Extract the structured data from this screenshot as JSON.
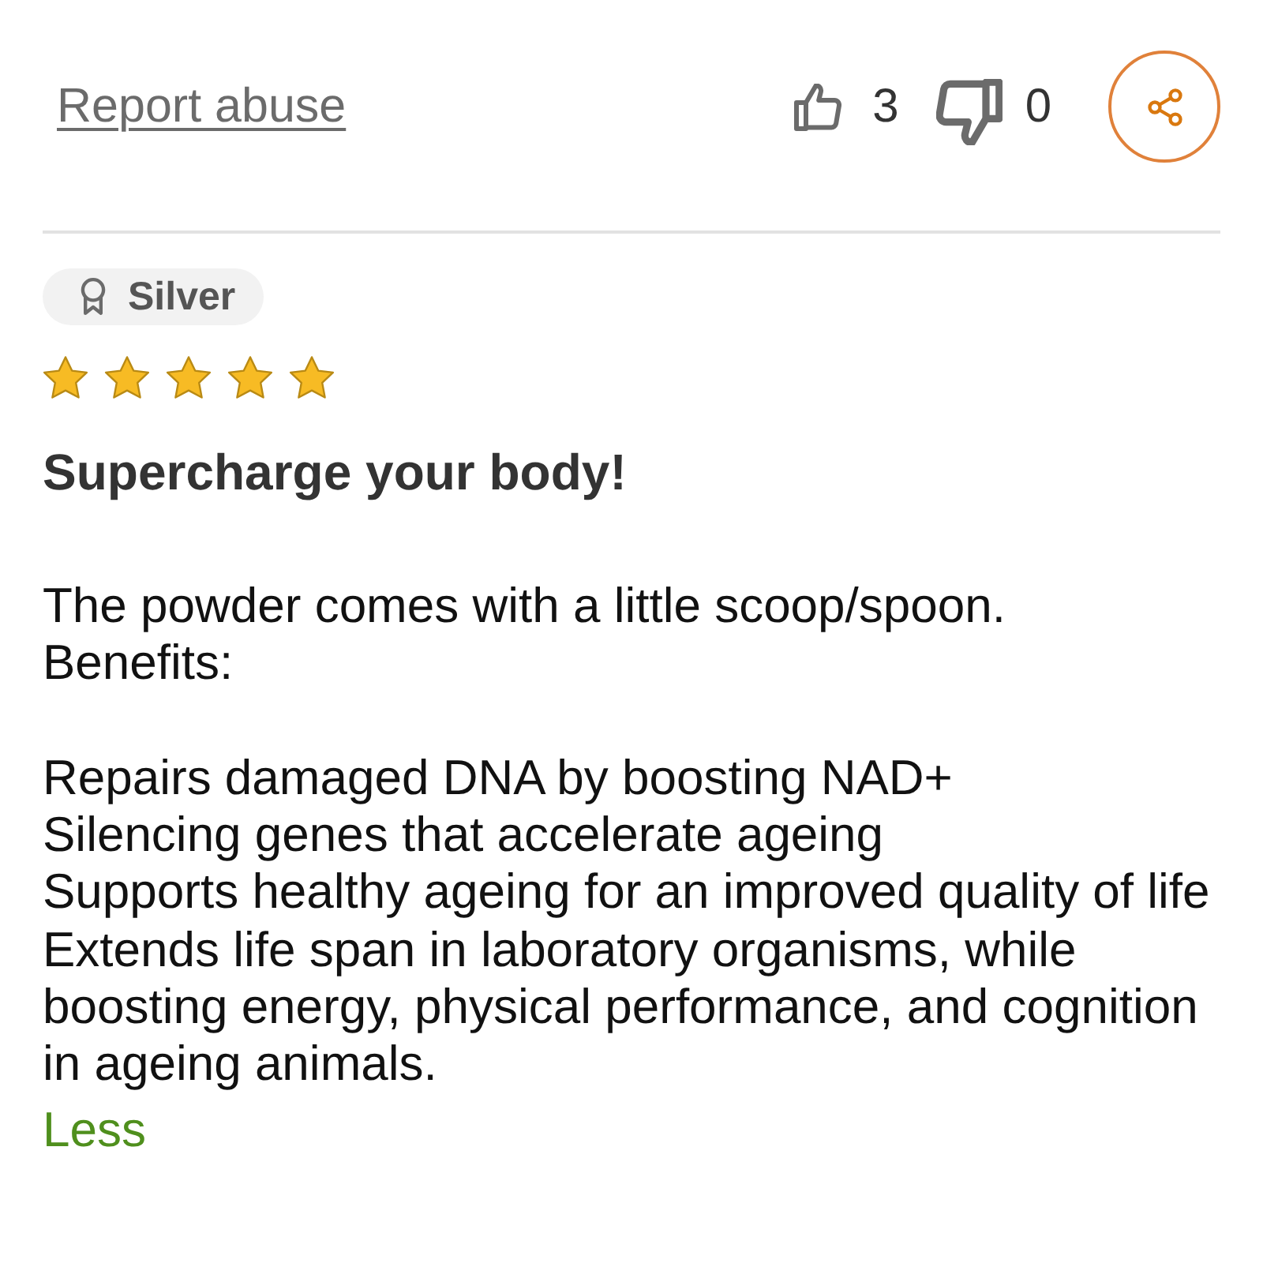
{
  "actions": {
    "report_link": "Report abuse",
    "likes": "3",
    "dislikes": "0"
  },
  "review": {
    "badge": "Silver",
    "stars": 5,
    "title": "Supercharge your body!",
    "body": [
      "The powder comes with a little scoop/spoon.\nBenefits:",
      "Repairs damaged DNA by boosting NAD+\nSilencing genes that accelerate ageing\nSupports healthy ageing for an improved quality of life\nExtends life span in laboratory organisms, while boosting energy, physical performance, and cognition in ageing animals."
    ],
    "toggle_link": "Less"
  }
}
